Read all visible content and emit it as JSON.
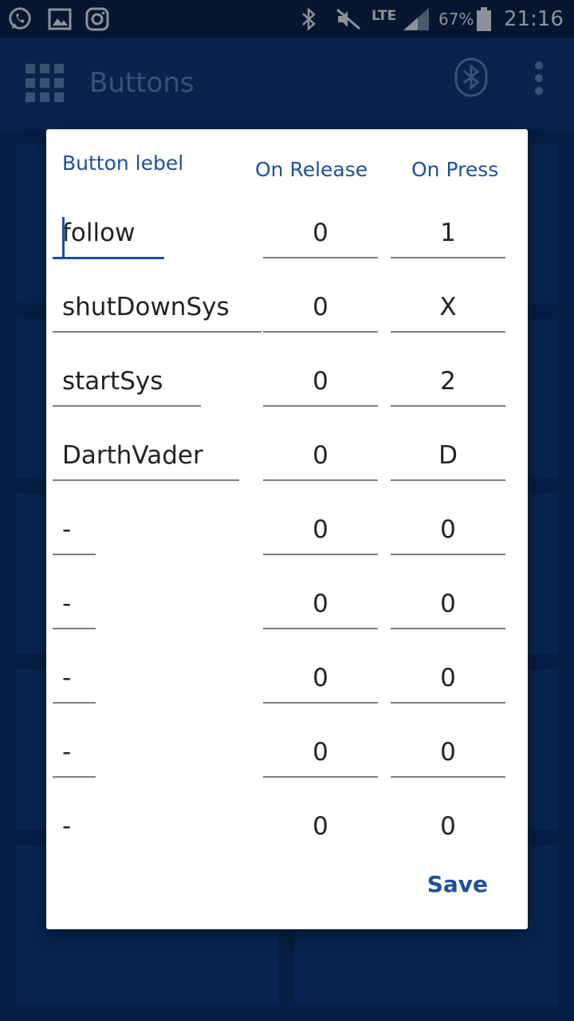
{
  "status_bar": {
    "battery": "67%",
    "time": "21:16",
    "network": "LTE"
  },
  "app_bar": {
    "title": "Buttons"
  },
  "dialog": {
    "headers": {
      "label": "Button lebel",
      "on_release": "On Release",
      "on_press": "On Press"
    },
    "rows": [
      {
        "label": "follow",
        "on_release": "0",
        "on_press": "1"
      },
      {
        "label": "shutDownSys",
        "on_release": "0",
        "on_press": "X"
      },
      {
        "label": "startSys",
        "on_release": "0",
        "on_press": "2"
      },
      {
        "label": "DarthVader",
        "on_release": "0",
        "on_press": "D"
      },
      {
        "label": "-",
        "on_release": "0",
        "on_press": "0"
      },
      {
        "label": "-",
        "on_release": "0",
        "on_press": "0"
      },
      {
        "label": "-",
        "on_release": "0",
        "on_press": "0"
      },
      {
        "label": "-",
        "on_release": "0",
        "on_press": "0"
      },
      {
        "label": "-",
        "on_release": "0",
        "on_press": "0"
      }
    ],
    "save_label": "Save"
  },
  "colors": {
    "accent": "#1e4f9c",
    "app_bar": "#103a74",
    "status_bar": "#0a1f40"
  }
}
